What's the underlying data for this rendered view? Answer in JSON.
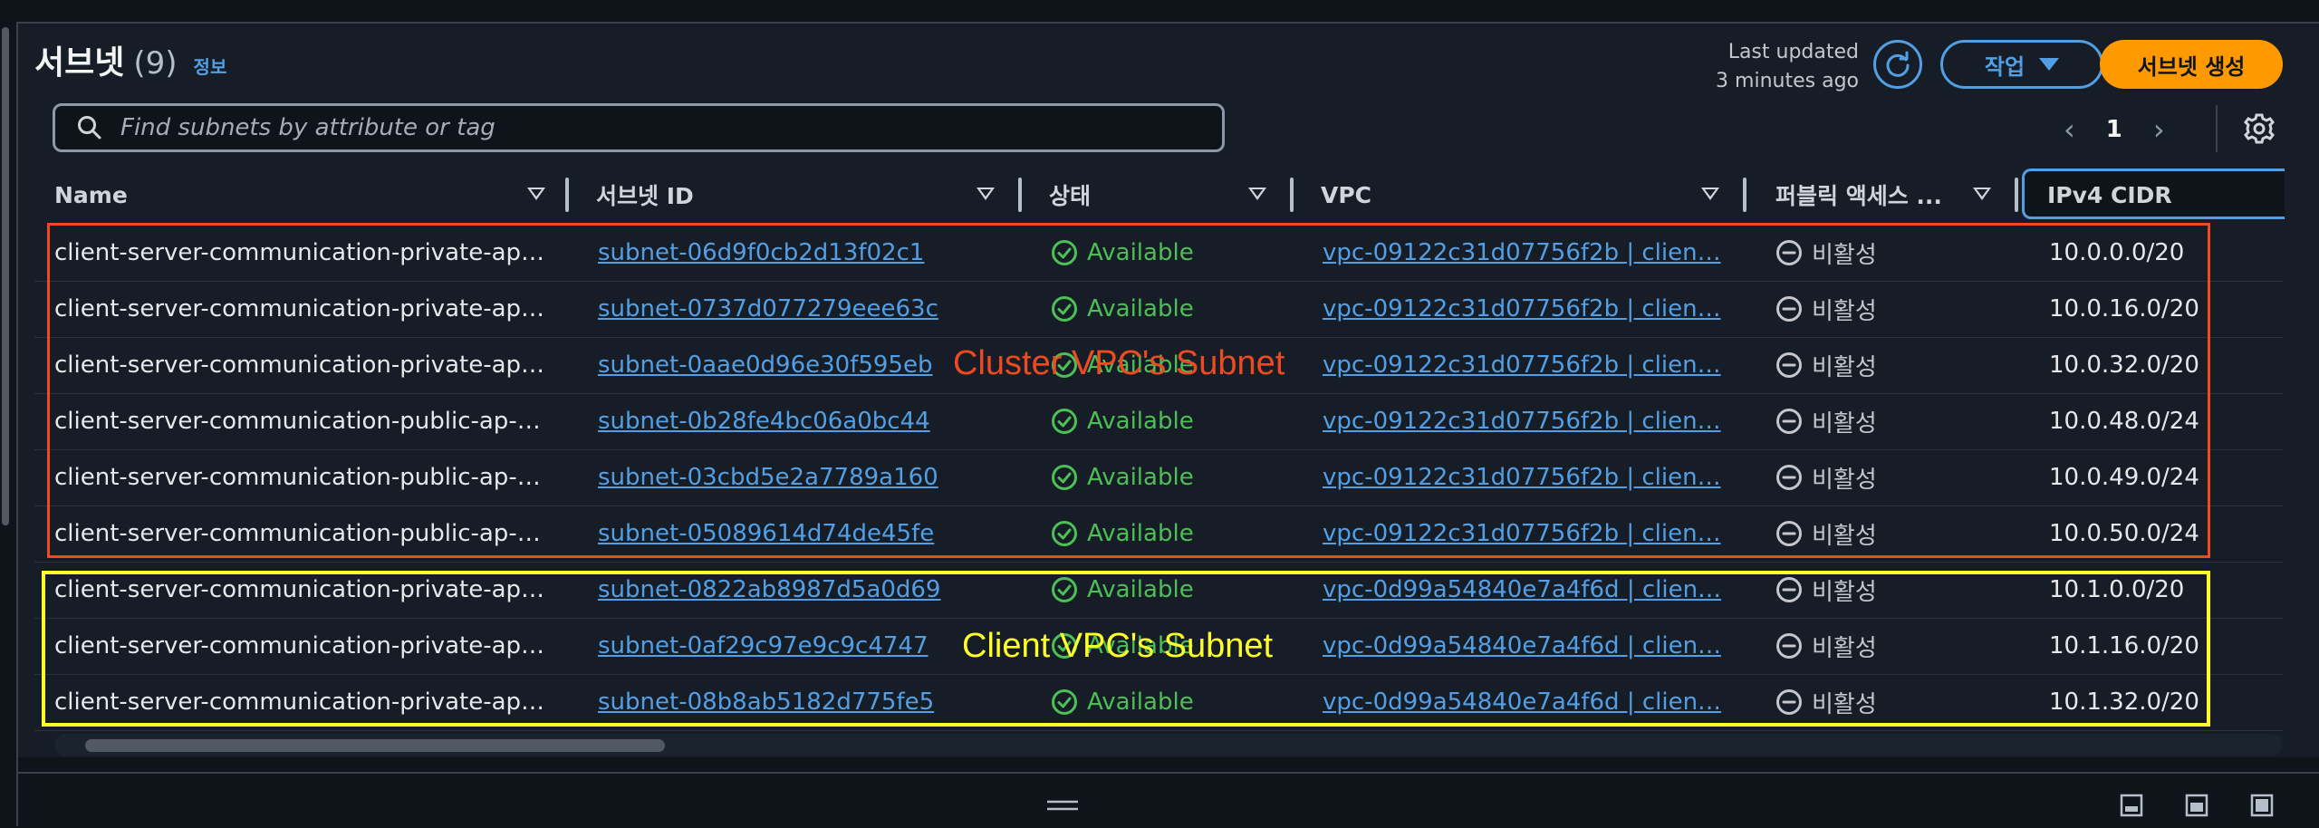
{
  "header": {
    "title": "서브넷",
    "count": "(9)",
    "info_link": "정보",
    "last_updated_line1": "Last updated",
    "last_updated_line2": "3 minutes ago",
    "actions_label": "작업",
    "create_label": "서브넷 생성"
  },
  "search": {
    "placeholder": "Find subnets by attribute or tag"
  },
  "pagination": {
    "current_page": "1"
  },
  "columns": [
    "Name",
    "서브넷 ID",
    "상태",
    "VPC",
    "퍼블릭 액세스 ...",
    "IPv4 CIDR"
  ],
  "rows": [
    {
      "name": "client-server-communication-private-ap…",
      "subnet_id": "subnet-06d9f0cb2d13f02c1",
      "state": "Available",
      "vpc": "vpc-09122c31d07756f2b | clien…",
      "public_access": "비활성",
      "cidr": "10.0.0.0/20"
    },
    {
      "name": "client-server-communication-private-ap…",
      "subnet_id": "subnet-0737d077279eee63c",
      "state": "Available",
      "vpc": "vpc-09122c31d07756f2b | clien…",
      "public_access": "비활성",
      "cidr": "10.0.16.0/20"
    },
    {
      "name": "client-server-communication-private-ap…",
      "subnet_id": "subnet-0aae0d96e30f595eb",
      "state": "Available",
      "vpc": "vpc-09122c31d07756f2b | clien…",
      "public_access": "비활성",
      "cidr": "10.0.32.0/20"
    },
    {
      "name": "client-server-communication-public-ap-…",
      "subnet_id": "subnet-0b28fe4bc06a0bc44",
      "state": "Available",
      "vpc": "vpc-09122c31d07756f2b | clien…",
      "public_access": "비활성",
      "cidr": "10.0.48.0/24"
    },
    {
      "name": "client-server-communication-public-ap-…",
      "subnet_id": "subnet-03cbd5e2a7789a160",
      "state": "Available",
      "vpc": "vpc-09122c31d07756f2b | clien…",
      "public_access": "비활성",
      "cidr": "10.0.49.0/24"
    },
    {
      "name": "client-server-communication-public-ap-…",
      "subnet_id": "subnet-05089614d74de45fe",
      "state": "Available",
      "vpc": "vpc-09122c31d07756f2b | clien…",
      "public_access": "비활성",
      "cidr": "10.0.50.0/24"
    },
    {
      "name": "client-server-communication-private-ap…",
      "subnet_id": "subnet-0822ab8987d5a0d69",
      "state": "Available",
      "vpc": "vpc-0d99a54840e7a4f6d | clien…",
      "public_access": "비활성",
      "cidr": "10.1.0.0/20"
    },
    {
      "name": "client-server-communication-private-ap…",
      "subnet_id": "subnet-0af29c97e9c9c4747",
      "state": "Available",
      "vpc": "vpc-0d99a54840e7a4f6d | clien…",
      "public_access": "비활성",
      "cidr": "10.1.16.0/20"
    },
    {
      "name": "client-server-communication-private-ap…",
      "subnet_id": "subnet-08b8ab5182d775fe5",
      "state": "Available",
      "vpc": "vpc-0d99a54840e7a4f6d | clien…",
      "public_access": "비활성",
      "cidr": "10.1.32.0/20"
    }
  ],
  "annotations": {
    "cluster_label": "Cluster VPC's Subnet",
    "client_label": "Client VPC's Subnet",
    "cluster_color": "#ee4a21",
    "client_color": "#ffff2a"
  },
  "colors": {
    "accent": "#539fe5",
    "primary_button": "#ff9900",
    "available": "#4cbf56",
    "background": "#161d26"
  },
  "icons": {
    "search": "search-icon",
    "refresh": "refresh-icon",
    "settings": "gear-icon",
    "available": "check-circle-icon",
    "inactive": "minus-circle-icon"
  }
}
